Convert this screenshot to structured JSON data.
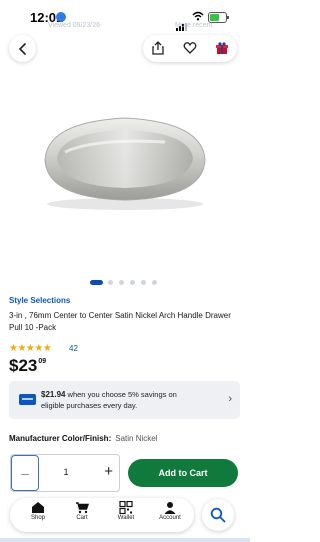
{
  "status_bar": {
    "time": "12:01"
  },
  "header_ghost": {
    "left_text": "Viewed 09/23/26",
    "right_text": "More recent"
  },
  "product": {
    "brand": "Style Selections",
    "title": "3-in , 76mm Center to Center Satin Nickel Arch Handle Drawer Pull 10 -Pack",
    "rating": 4.5,
    "review_count": "42",
    "price_dollars": "$23",
    "price_cents": "09",
    "image_pages": 6,
    "active_image_index": 0
  },
  "promo": {
    "amount": "$21.94",
    "text_1": " when you choose 5% savings on",
    "text_2": "eligible purchases every day.",
    "chevron": "›"
  },
  "finish": {
    "label": "Manufacturer Color/Finish:",
    "value": "Satin Nickel"
  },
  "quantity": {
    "minus": "–",
    "value": "1",
    "plus": "+"
  },
  "add_to_cart": {
    "label": "Add to Cart"
  },
  "tabbar": {
    "shop": "Shop",
    "cart": "Cart",
    "wallet": "Wallet",
    "account": "Account"
  },
  "icons": {
    "back": "chevron-left-icon",
    "share": "share-icon",
    "favorite": "heart-icon",
    "gift": "gift-icon",
    "search": "search-icon"
  },
  "colors": {
    "brand_blue": "#0b57c2",
    "cta_green": "#0f7a3b",
    "star": "#f2a812"
  }
}
